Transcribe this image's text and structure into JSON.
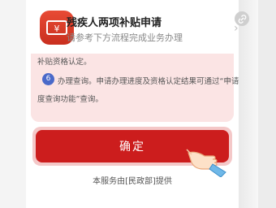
{
  "header": {
    "title": "残疾人两项补贴申请",
    "subtitle": "请参考下方流程完成业务办理"
  },
  "panel": {
    "line1": "补贴资格认定。",
    "step_number": "6",
    "line2": "办理查询。申请办理进度及资格认定结果可通过“申请进",
    "line3": "度查询功能”查询。"
  },
  "confirm": {
    "label": "确定"
  },
  "provider": "本服务由[民政部]提供",
  "colors": {
    "brand_red": "#cc1d1d",
    "panel_pink": "#fbe4e4",
    "step_blue": "#4a69c9"
  },
  "icons": {
    "app": "ticket-icon",
    "link": "link-icon",
    "chevron": "chevron-right-icon",
    "pointer": "pointing-hand-icon"
  }
}
